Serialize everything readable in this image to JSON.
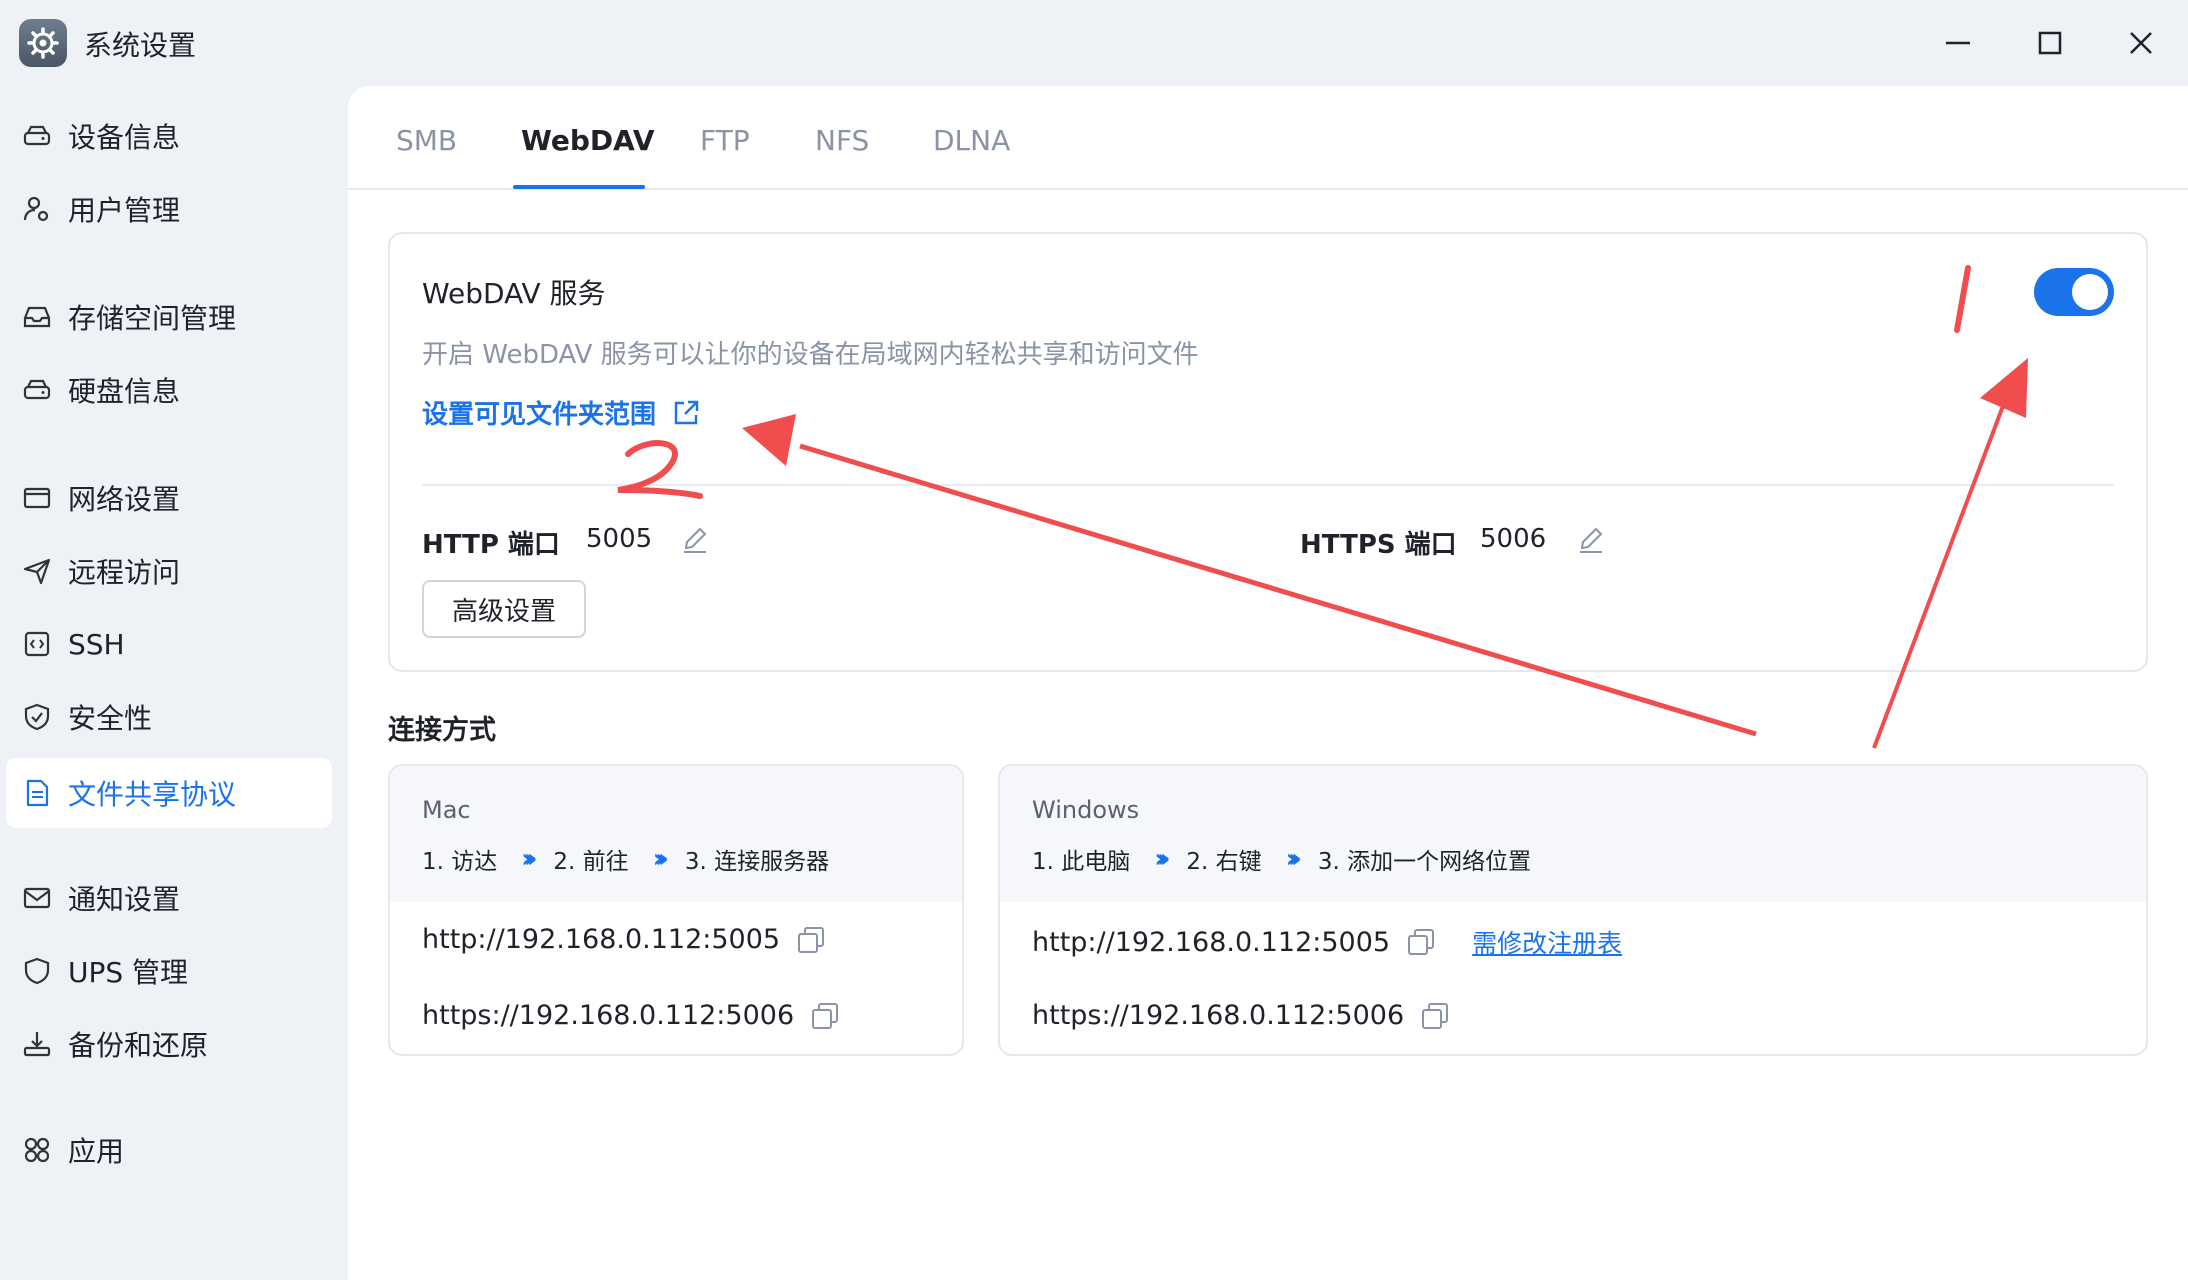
{
  "window": {
    "title": "系统设置",
    "controls": [
      "minimize-icon",
      "maximize-icon",
      "close-icon"
    ]
  },
  "sidebar": {
    "items": [
      {
        "label": "设备信息",
        "icon": "drive-icon"
      },
      {
        "label": "用户管理",
        "icon": "user-gear-icon"
      },
      {
        "label": "存储空间管理",
        "icon": "storage-icon"
      },
      {
        "label": "硬盘信息",
        "icon": "disk-icon"
      },
      {
        "label": "网络设置",
        "icon": "network-icon"
      },
      {
        "label": "远程访问",
        "icon": "send-icon"
      },
      {
        "label": "SSH",
        "icon": "code-icon"
      },
      {
        "label": "安全性",
        "icon": "shield-check-icon"
      },
      {
        "label": "文件共享协议",
        "icon": "document-icon",
        "active": true
      },
      {
        "label": "通知设置",
        "icon": "mail-icon"
      },
      {
        "label": "UPS 管理",
        "icon": "shield-icon"
      },
      {
        "label": "备份和还原",
        "icon": "backup-icon"
      },
      {
        "label": "应用",
        "icon": "apps-icon"
      }
    ],
    "active_color": "#1a73e8"
  },
  "tabs": [
    {
      "label": "SMB"
    },
    {
      "label": "WebDAV",
      "active": true
    },
    {
      "label": "FTP"
    },
    {
      "label": "NFS"
    },
    {
      "label": "DLNA"
    }
  ],
  "service": {
    "title": "WebDAV 服务",
    "description": "开启 WebDAV 服务可以让你的设备在局域网内轻松共享和访问文件",
    "folder_link": "设置可见文件夹范围",
    "enabled": true,
    "http_label": "HTTP 端口",
    "http_port": "5005",
    "https_label": "HTTPS 端口",
    "https_port": "5006",
    "advanced_button": "高级设置"
  },
  "connection": {
    "title": "连接方式",
    "mac": {
      "os": "Mac",
      "steps": [
        "1. 访达",
        "2. 前往",
        "3. 连接服务器"
      ],
      "http_url": "http://192.168.0.112:5005",
      "https_url": "https://192.168.0.112:5006"
    },
    "windows": {
      "os": "Windows",
      "steps": [
        "1. 此电脑",
        "2. 右键",
        "3. 添加一个网络位置"
      ],
      "http_url": "http://192.168.0.112:5005",
      "registry_link": "需修改注册表",
      "https_url": "https://192.168.0.112:5006"
    }
  },
  "annotations": {
    "mark_1": "1",
    "mark_2": "2",
    "color": "#f04e4e"
  }
}
